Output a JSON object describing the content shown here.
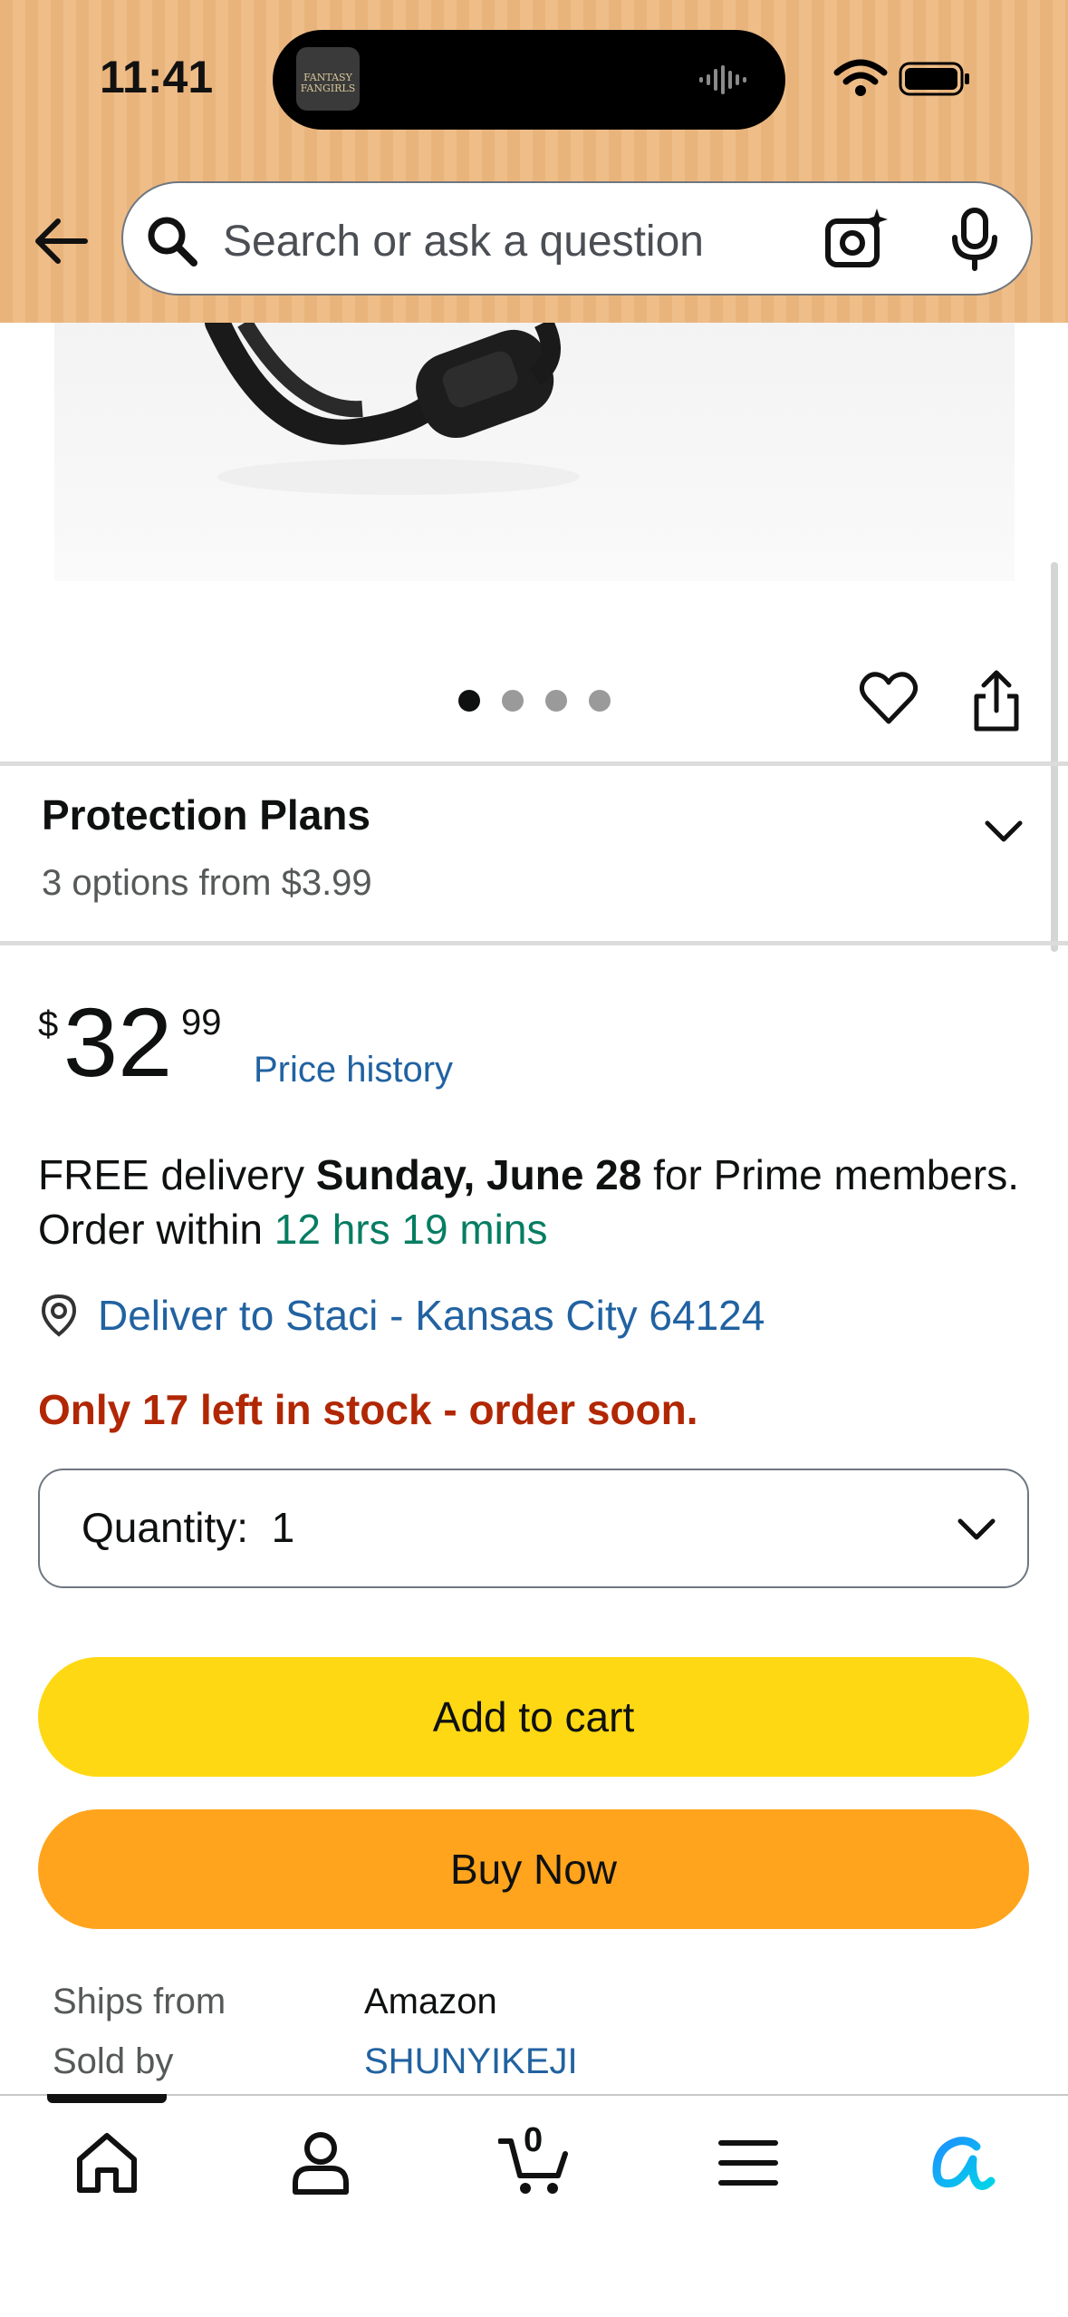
{
  "status_bar": {
    "time": "11:41",
    "island_app_label": "FANTASY FANGIRLS"
  },
  "header": {
    "search_placeholder": "Search or ask a question"
  },
  "image_carousel": {
    "dot_count": 4,
    "active_index": 0
  },
  "protection_plans": {
    "title": "Protection Plans",
    "subtitle": "3 options from $3.99"
  },
  "price": {
    "symbol": "$",
    "whole": "32",
    "fraction": "99",
    "history_link": "Price history"
  },
  "delivery": {
    "prefix": "FREE delivery ",
    "date": "Sunday, June 28",
    "middle": " for Prime members. Order within ",
    "countdown": "12 hrs 19 mins"
  },
  "location": {
    "link": "Deliver to Staci - Kansas City 64124"
  },
  "stock": {
    "text": "Only 17 left in stock - order soon."
  },
  "quantity": {
    "label": "Quantity:",
    "value": "1"
  },
  "buttons": {
    "add_to_cart": "Add to cart",
    "buy_now": "Buy Now"
  },
  "seller_info": {
    "ships_from_label": "Ships from",
    "ships_from_value": "Amazon",
    "sold_by_label": "Sold by",
    "sold_by_value": "SHUNYIKEJI"
  },
  "bottom_nav": {
    "cart_count": "0",
    "items": [
      "home-icon",
      "account-icon",
      "cart-icon",
      "menu-icon",
      "rufus-assistant-icon"
    ]
  },
  "colors": {
    "header_bg": "#eebd88",
    "link": "#2162a1",
    "countdown": "#067d62",
    "stock_warning": "#b12704",
    "add_to_cart": "#ffd814",
    "buy_now": "#ffa41c"
  }
}
